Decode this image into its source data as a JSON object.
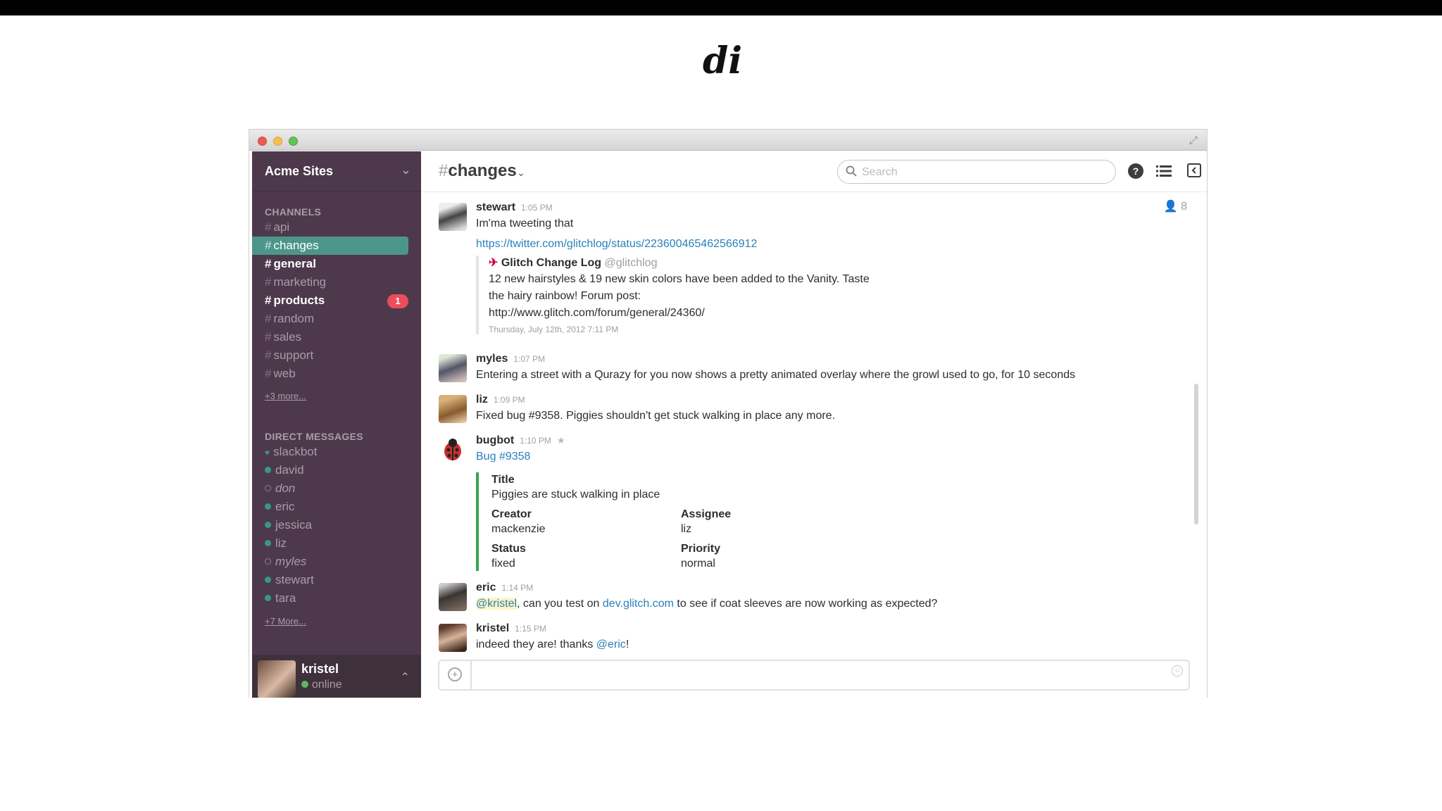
{
  "logo_text": "di",
  "team": {
    "name": "Acme Sites"
  },
  "sidebar": {
    "channels_header": "CHANNELS",
    "channels": [
      {
        "hash": "#",
        "label": "api"
      },
      {
        "hash": "#",
        "label": "changes"
      },
      {
        "hash": "#",
        "label": "general"
      },
      {
        "hash": "#",
        "label": "marketing"
      },
      {
        "hash": "#",
        "label": "products",
        "badge": "1"
      },
      {
        "hash": "#",
        "label": "random"
      },
      {
        "hash": "#",
        "label": "sales"
      },
      {
        "hash": "#",
        "label": "support"
      },
      {
        "hash": "#",
        "label": "web"
      }
    ],
    "channels_more": "+3 more...",
    "dm_header": "DIRECT MESSAGES",
    "dms": [
      "slackbot",
      "david",
      "don",
      "eric",
      "jessica",
      "liz",
      "myles",
      "stewart",
      "tara"
    ],
    "dms_more": "+7 More...",
    "me": {
      "name": "kristel",
      "status": "online"
    }
  },
  "header": {
    "hash": "#",
    "channel": "changes",
    "search_placeholder": "Search",
    "help": "?",
    "members_count": "8"
  },
  "messages": {
    "stewart": {
      "user": "stewart",
      "time": "1:05 PM",
      "text": "Im'ma tweeting that",
      "link": "https://twitter.com/glitchlog/status/223600465462566912",
      "attachment": {
        "author": "Glitch Change Log",
        "handle": "@glitchlog",
        "text1": "12 new hairstyles & 19 new skin colors have been added to the Vanity. Taste",
        "text2": "the hairy rainbow! Forum post:",
        "link": "http://www.glitch.com/forum/general/24360/",
        "date": "Thursday, July 12th, 2012 7:11 PM"
      }
    },
    "myles": {
      "user": "myles",
      "time": "1:07 PM",
      "text": "Entering a street with a Qurazy for you now shows a pretty animated overlay where the growl used to go, for 10 seconds"
    },
    "liz": {
      "user": "liz",
      "time": "1:09 PM",
      "text": "Fixed bug #9358. Piggies shouldn't get stuck walking in place any more."
    },
    "bugbot": {
      "user": "bugbot",
      "time": "1:10 PM",
      "link": "Bug #9358",
      "title_label": "Title",
      "title_value": "Piggies are stuck walking in place",
      "creator_label": "Creator",
      "creator_value": "mackenzie",
      "assignee_label": "Assignee",
      "assignee_value": "liz",
      "status_label": "Status",
      "status_value": "fixed",
      "priority_label": "Priority",
      "priority_value": "normal"
    },
    "eric": {
      "user": "eric",
      "time": "1:14 PM",
      "mention": "@kristel",
      "text_a": ", can you test on ",
      "link": "dev.glitch.com",
      "text_b": " to see if coat sleeves are now working as expected?"
    },
    "kristel": {
      "user": "kristel",
      "time": "1:15 PM",
      "text_a": "indeed they are! thanks ",
      "mention": "@eric",
      "text_b": "!"
    }
  },
  "composer": {
    "placeholder": "",
    "upload": "+",
    "emoji": "☺"
  },
  "colors": {
    "sidebar": "#4d394b",
    "active": "#4c9689",
    "badge": "#eb4d5c",
    "link": "#2a80b9"
  }
}
